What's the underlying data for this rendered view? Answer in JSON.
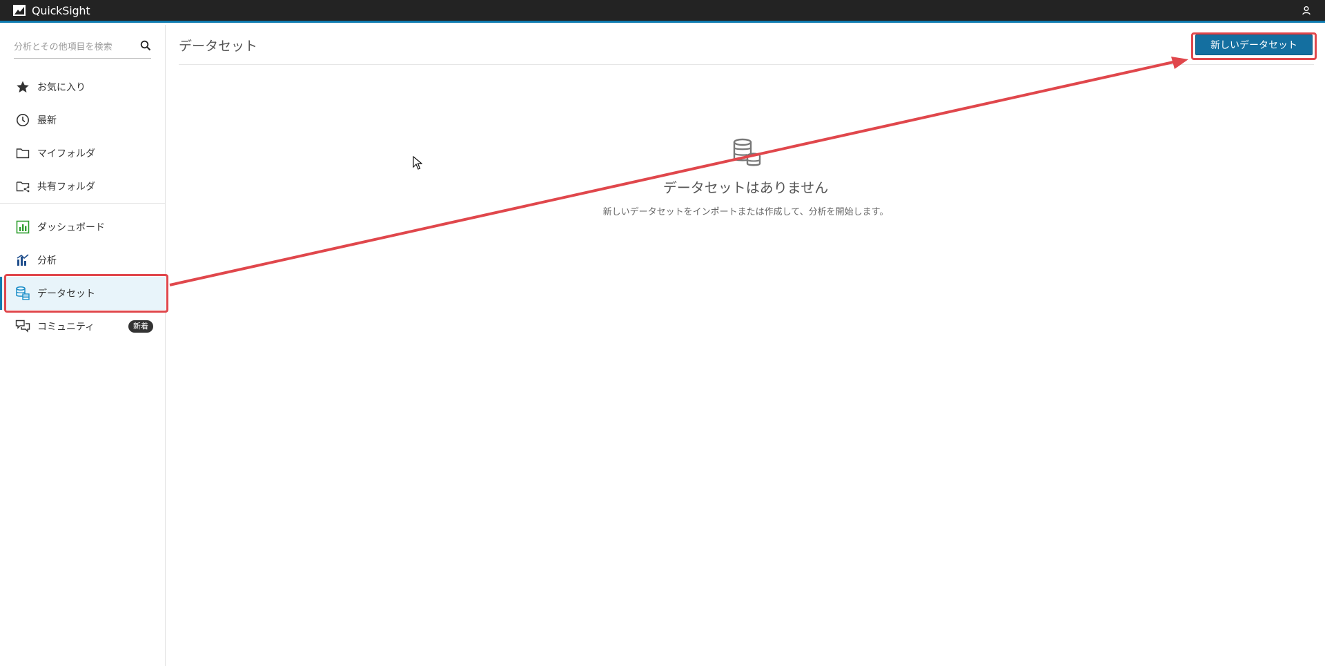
{
  "app": {
    "name": "QuickSight"
  },
  "search": {
    "placeholder": "分析とその他項目を検索"
  },
  "sidebar": {
    "items": [
      {
        "label": "お気に入り",
        "icon": "star-icon"
      },
      {
        "label": "最新",
        "icon": "clock-icon"
      },
      {
        "label": "マイフォルダ",
        "icon": "folder-icon"
      },
      {
        "label": "共有フォルダ",
        "icon": "shared-folder-icon"
      },
      {
        "label": "ダッシュボード",
        "icon": "dashboard-icon"
      },
      {
        "label": "分析",
        "icon": "analysis-icon"
      },
      {
        "label": "データセット",
        "icon": "dataset-icon",
        "active": true
      },
      {
        "label": "コミュニティ",
        "icon": "community-icon",
        "badge": "新着"
      }
    ]
  },
  "main": {
    "title": "データセット",
    "new_button_label": "新しいデータセット",
    "empty_state": {
      "title": "データセットはありません",
      "description": "新しいデータセットをインポートまたは作成して、分析を開始します。"
    }
  },
  "colors": {
    "topbar": "#232323",
    "accent": "#0f7bb0",
    "primary_button": "#146fa0",
    "annotation": "#e0474c"
  }
}
